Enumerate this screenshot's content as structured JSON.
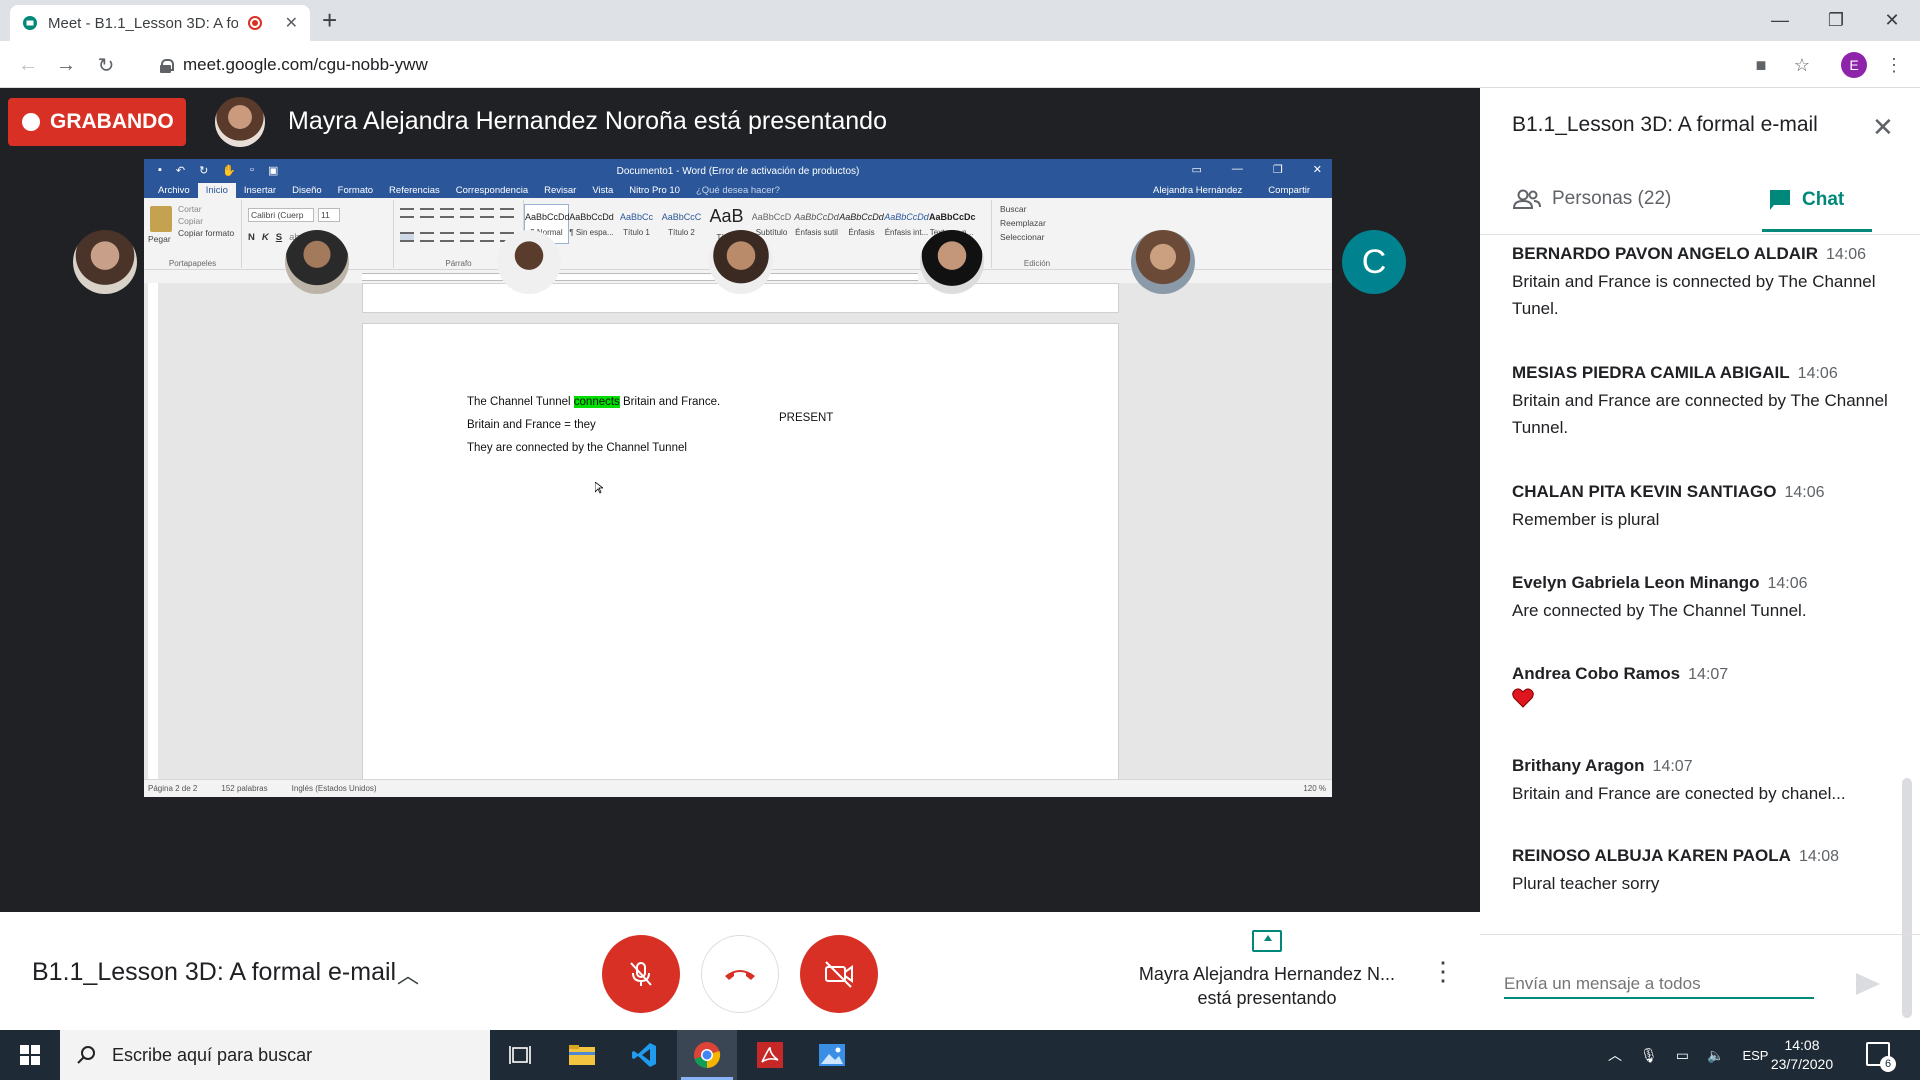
{
  "browser": {
    "tab_title": "Meet - B1.1_Lesson 3D: A for",
    "new_tab": "+",
    "url": "meet.google.com/cgu-nobb-yww",
    "profile_initial": "E"
  },
  "stage": {
    "recording_label": "GRABANDO",
    "presenting_text": "Mayra Alejandra Hernandez Noroña está presentando"
  },
  "word": {
    "title": "Documento1 - Word (Error de activación de productos)",
    "menu": [
      "Archivo",
      "Inicio",
      "Insertar",
      "Diseño",
      "Formato",
      "Referencias",
      "Correspondencia",
      "Revisar",
      "Vista",
      "Nitro Pro 10"
    ],
    "tell_me": "¿Qué desea hacer?",
    "user": "Alejandra Hernández",
    "share": "Compartir",
    "clipboard": {
      "paste": "Pegar",
      "cut": "Cortar",
      "copy": "Copiar",
      "format": "Copiar formato",
      "group": "Portapapeles"
    },
    "font": {
      "name": "Calibri (Cuerp",
      "size": "11",
      "group": "Fuente"
    },
    "paragraph_group": "Párrafo",
    "styles": [
      {
        "sample": "AaBbCcDd",
        "name": "¶ Normal"
      },
      {
        "sample": "AaBbCcDd",
        "name": "¶ Sin espa..."
      },
      {
        "sample": "AaBbCc",
        "name": "Título 1"
      },
      {
        "sample": "AaBbCcC",
        "name": "Título 2"
      },
      {
        "sample": "AaB",
        "name": "Título"
      },
      {
        "sample": "AaBbCcD",
        "name": "Subtítulo"
      },
      {
        "sample": "AaBbCcDd",
        "name": "Énfasis sutil"
      },
      {
        "sample": "AaBbCcDd",
        "name": "Énfasis"
      },
      {
        "sample": "AaBbCcDd",
        "name": "Énfasis int..."
      },
      {
        "sample": "AaBbCcDc",
        "name": "Texto en n..."
      }
    ],
    "styles_group": "Estilos",
    "editing": {
      "find": "Buscar",
      "replace": "Reemplazar",
      "select": "Seleccionar",
      "group": "Edición"
    },
    "doc": {
      "line1_before": "The Channel Tunnel ",
      "line1_highlight": "connects",
      "line1_after": " Britain and France.",
      "present": "PRESENT",
      "line2": "Britain and France = they",
      "line3": "They are connected by the Channel Tunnel"
    },
    "status": {
      "page": "Página 2 de 2",
      "words": "152 palabras",
      "lang": "Inglés (Estados Unidos)",
      "zoom": "120 %"
    }
  },
  "filmstrip": {
    "last_initial": "C"
  },
  "bottombar": {
    "meeting_title": "B1.1_Lesson 3D: A formal e-mail",
    "presenter_line1": "Mayra Alejandra Hernandez N...",
    "presenter_line2": "está presentando"
  },
  "panel": {
    "title": "B1.1_Lesson 3D: A formal e-mail",
    "people_tab": "Personas (22)",
    "chat_tab": "Chat",
    "messages": [
      {
        "sender": "BERNARDO PAVON ANGELO ALDAIR",
        "time": "14:06",
        "text": "Britain and France is connected by The Channel Tunel."
      },
      {
        "sender": "MESIAS PIEDRA CAMILA ABIGAIL",
        "time": "14:06",
        "text": "Britain and France are connected by The Channel Tunnel."
      },
      {
        "sender": "CHALAN PITA KEVIN SANTIAGO",
        "time": "14:06",
        "text": "Remember is plural"
      },
      {
        "sender": "Evelyn Gabriela Leon Minango",
        "time": "14:06",
        "text": "Are connected by The Channel Tunnel."
      },
      {
        "sender": "Andrea Cobo Ramos",
        "time": "14:07",
        "text": ""
      },
      {
        "sender": "Brithany Aragon",
        "time": "14:07",
        "text": "Britain and France are conected by chanel..."
      },
      {
        "sender": "REINOSO ALBUJA KAREN PAOLA",
        "time": "14:08",
        "text": "Plural teacher sorry"
      }
    ],
    "input_placeholder": "Envía un mensaje a todos"
  },
  "taskbar": {
    "search_placeholder": "Escribe aquí para buscar",
    "lang": "ESP",
    "time": "14:08",
    "date": "23/7/2020",
    "notifications": "6"
  },
  "colors": {
    "accent": "#00897b",
    "record": "#d93025",
    "word_blue": "#2b579a",
    "highlight": "#00e000"
  }
}
